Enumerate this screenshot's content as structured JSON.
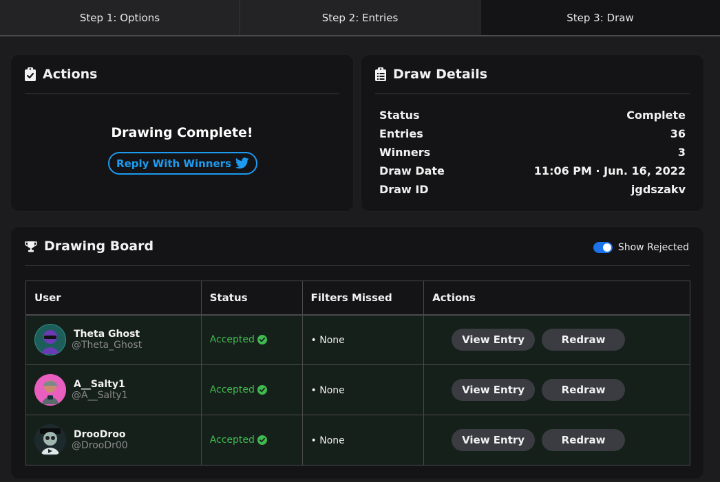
{
  "steps": [
    "Step 1: Options",
    "Step 2: Entries",
    "Step 3: Draw"
  ],
  "actions": {
    "title": "Actions",
    "complete_text": "Drawing Complete!",
    "reply_button": "Reply With Winners"
  },
  "details": {
    "title": "Draw Details",
    "rows": [
      {
        "label": "Status",
        "value": "Complete"
      },
      {
        "label": "Entries",
        "value": "36"
      },
      {
        "label": "Winners",
        "value": "3"
      },
      {
        "label": "Draw Date",
        "value": "11:06 PM · Jun. 16, 2022"
      },
      {
        "label": "Draw ID",
        "value": "jgdszakv"
      }
    ]
  },
  "board": {
    "title": "Drawing Board",
    "toggle_label": "Show Rejected",
    "toggle_on": true,
    "columns": [
      "User",
      "Status",
      "Filters Missed",
      "Actions"
    ],
    "rows": [
      {
        "name": "Theta Ghost",
        "handle": "@Theta_Ghost",
        "status": "Accepted",
        "filters": "• None",
        "view": "View Entry",
        "redraw": "Redraw",
        "avatar_bg": "#2f8f87",
        "avatar_fg": "#6b3bb5"
      },
      {
        "name": "A__Salty1",
        "handle": "@A__Salty1",
        "status": "Accepted",
        "filters": "• None",
        "view": "View Entry",
        "redraw": "Redraw",
        "avatar_bg": "#e85fc0",
        "avatar_fg": "#7a8a8c"
      },
      {
        "name": "DrooDroo",
        "handle": "@DrooDr00",
        "status": "Accepted",
        "filters": "• None",
        "view": "View Entry",
        "redraw": "Redraw",
        "avatar_bg": "#1c2a2e",
        "avatar_fg": "#9fb6b0"
      }
    ]
  },
  "colors": {
    "accent": "#1d9bf0",
    "accepted": "#3fb950",
    "toggle": "#1a73e8"
  }
}
